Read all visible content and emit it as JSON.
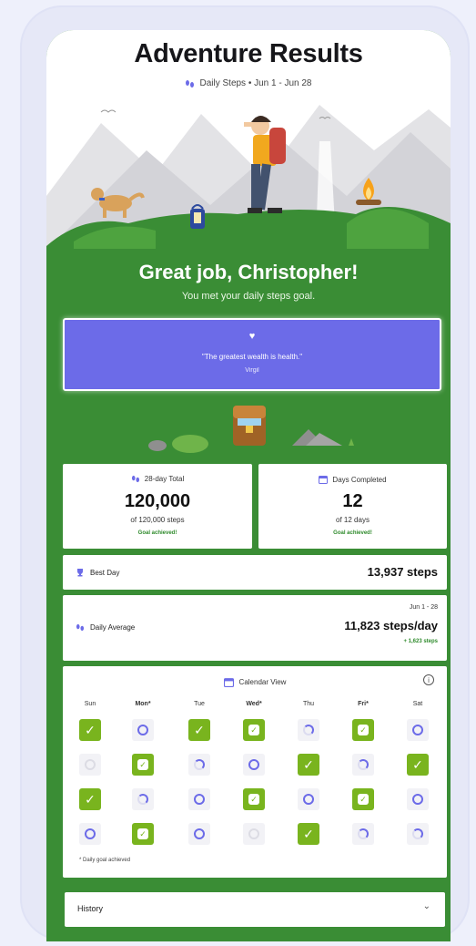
{
  "header": {
    "title": "Adventure Results",
    "subtitle": "Daily Steps • Jun 1 - Jun 28"
  },
  "greeting": {
    "title": "Great job, Christopher!",
    "subtitle": "You met your daily steps goal."
  },
  "quote": {
    "text": "\"The greatest wealth is health.\"",
    "author": "Virgil"
  },
  "stats": {
    "total": {
      "label": "28-day Total",
      "value": "120,000",
      "detail": "of 120,000 steps",
      "goal": "Goal achieved!"
    },
    "days": {
      "label": "Days Completed",
      "value": "12",
      "detail": "of 12 days",
      "goal": "Goal achieved!"
    }
  },
  "best_day": {
    "label": "Best Day",
    "value": "13,937 steps"
  },
  "daily_average": {
    "label": "Daily Average",
    "range": "Jun 1 - 28",
    "value": "11,823 steps/day",
    "delta": "+ 1,623 steps"
  },
  "calendar": {
    "title": "Calendar View",
    "days": [
      "Sun",
      "Mon*",
      "Tue",
      "Wed*",
      "Thu",
      "Fri*",
      "Sat"
    ],
    "legend": "* Daily goal achieved",
    "rows": [
      [
        "done",
        "ring",
        "done",
        "done-shield",
        "ring-part",
        "done-shield",
        "ring"
      ],
      [
        "empty",
        "done-shield",
        "ring-part",
        "ring",
        "done",
        "ring-part",
        "done"
      ],
      [
        "done",
        "ring-part",
        "ring",
        "done-shield",
        "ring",
        "done-shield",
        "ring"
      ],
      [
        "ring",
        "done-shield",
        "ring",
        "empty",
        "done",
        "ring-part",
        "ring-part"
      ]
    ]
  },
  "history": {
    "label": "History"
  },
  "colors": {
    "green": "#3a8d35",
    "accent": "#6c6be8",
    "check": "#79b41e"
  }
}
